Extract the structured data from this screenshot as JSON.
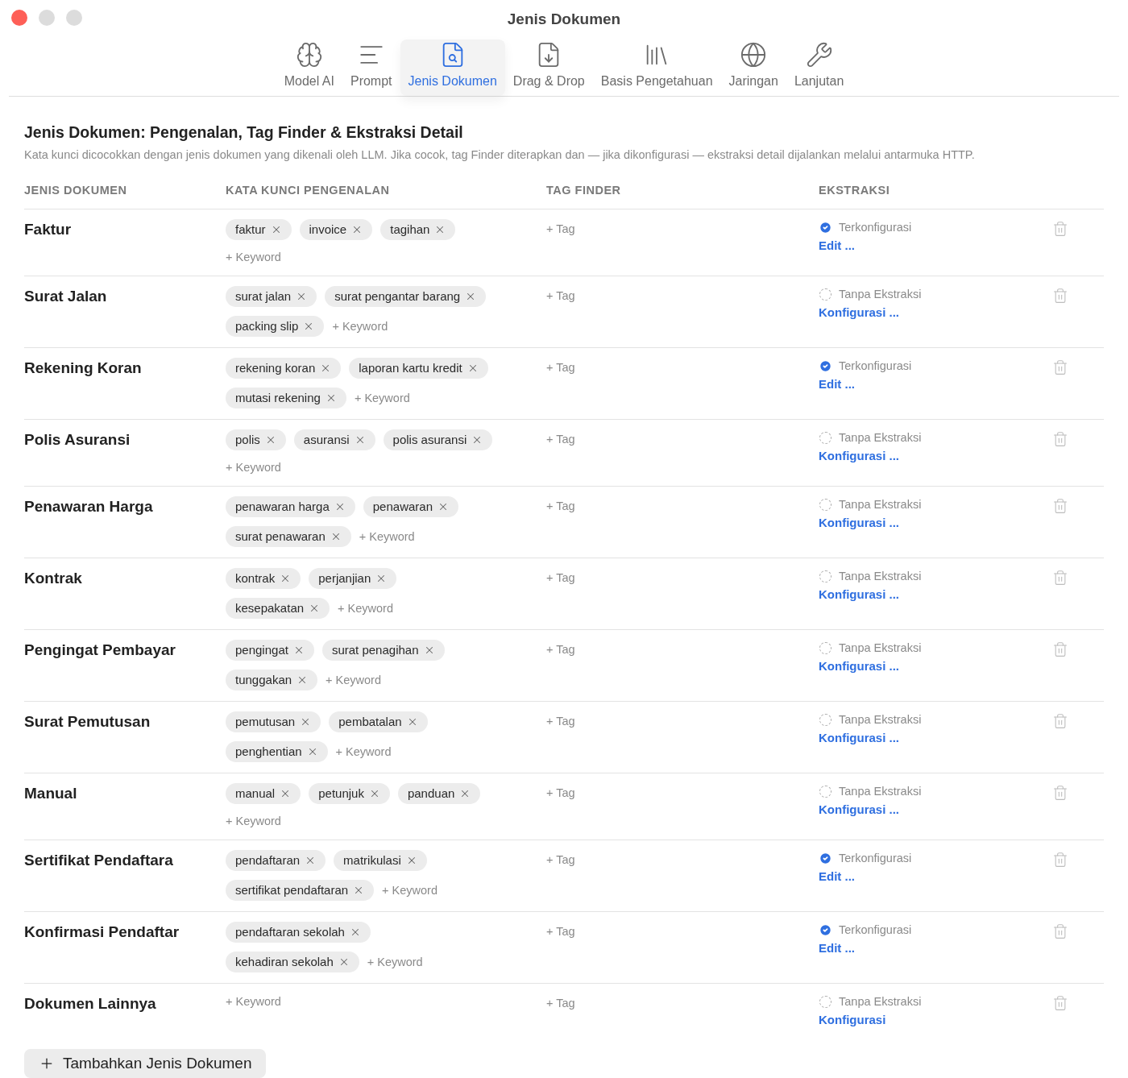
{
  "window": {
    "title": "Jenis Dokumen"
  },
  "tabs": [
    {
      "label": "Model AI",
      "selected": false
    },
    {
      "label": "Prompt",
      "selected": false
    },
    {
      "label": "Jenis Dokumen",
      "selected": true
    },
    {
      "label": "Drag & Drop",
      "selected": false
    },
    {
      "label": "Basis Pengetahuan",
      "selected": false
    },
    {
      "label": "Jaringan",
      "selected": false
    },
    {
      "label": "Lanjutan",
      "selected": false
    }
  ],
  "section": {
    "title": "Jenis Dokumen: Pengenalan, Tag Finder & Ekstraksi Detail",
    "description": "Kata kunci dicocokkan dengan jenis dokumen yang dikenali oleh LLM. Jika cocok, tag Finder diterapkan dan — jika dikonfigurasi — ekstraksi detail dijalankan melalui antarmuka HTTP."
  },
  "table": {
    "columns": [
      "JENIS DOKUMEN",
      "KATA KUNCI PENGENALAN",
      "TAG FINDER",
      "EKSTRAKSI"
    ],
    "rows": [
      {
        "name": "Faktur",
        "keywords": [
          "faktur",
          "invoice",
          "tagihan"
        ],
        "add_keyword": "+ Keyword",
        "add_tag": "+ Tag",
        "configured": true,
        "status": "Terkonfigurasi",
        "action": "Edit ..."
      },
      {
        "name": "Surat Jalan",
        "keywords": [
          "surat jalan",
          "surat pengantar barang",
          "packing slip"
        ],
        "add_keyword": "+ Keyword",
        "add_tag": "+ Tag",
        "configured": false,
        "status": "Tanpa Ekstraksi",
        "action": "Konfigurasi ..."
      },
      {
        "name": "Rekening Koran",
        "keywords": [
          "rekening koran",
          "laporan kartu kredit",
          "mutasi rekening"
        ],
        "add_keyword": "+ Keyword",
        "add_tag": "+ Tag",
        "configured": true,
        "status": "Terkonfigurasi",
        "action": "Edit ..."
      },
      {
        "name": "Polis Asuransi",
        "keywords": [
          "polis",
          "asuransi",
          "polis asuransi"
        ],
        "add_keyword": "+ Keyword",
        "add_tag": "+ Tag",
        "configured": false,
        "status": "Tanpa Ekstraksi",
        "action": "Konfigurasi ..."
      },
      {
        "name": "Penawaran Harga",
        "keywords": [
          "penawaran harga",
          "penawaran",
          "surat penawaran"
        ],
        "add_keyword": "+ Keyword",
        "add_tag": "+ Tag",
        "configured": false,
        "status": "Tanpa Ekstraksi",
        "action": "Konfigurasi ..."
      },
      {
        "name": "Kontrak",
        "keywords": [
          "kontrak",
          "perjanjian",
          "kesepakatan"
        ],
        "add_keyword": "+ Keyword",
        "add_tag": "+ Tag",
        "configured": false,
        "status": "Tanpa Ekstraksi",
        "action": "Konfigurasi ..."
      },
      {
        "name": "Pengingat Pembayar",
        "keywords": [
          "pengingat",
          "surat penagihan",
          "tunggakan"
        ],
        "add_keyword": "+ Keyword",
        "add_tag": "+ Tag",
        "configured": false,
        "status": "Tanpa Ekstraksi",
        "action": "Konfigurasi ..."
      },
      {
        "name": "Surat Pemutusan",
        "keywords": [
          "pemutusan",
          "pembatalan",
          "penghentian"
        ],
        "add_keyword": "+ Keyword",
        "add_tag": "+ Tag",
        "configured": false,
        "status": "Tanpa Ekstraksi",
        "action": "Konfigurasi ..."
      },
      {
        "name": "Manual",
        "keywords": [
          "manual",
          "petunjuk",
          "panduan"
        ],
        "add_keyword": "+ Keyword",
        "add_tag": "+ Tag",
        "configured": false,
        "status": "Tanpa Ekstraksi",
        "action": "Konfigurasi ..."
      },
      {
        "name": "Sertifikat Pendaftara",
        "keywords": [
          "pendaftaran",
          "matrikulasi",
          "sertifikat pendaftaran"
        ],
        "add_keyword": "+ Keyword",
        "add_tag": "+ Tag",
        "configured": true,
        "status": "Terkonfigurasi",
        "action": "Edit ..."
      },
      {
        "name": "Konfirmasi Pendaftar",
        "keywords": [
          "pendaftaran sekolah",
          "kehadiran sekolah"
        ],
        "add_keyword": "+ Keyword",
        "add_tag": "+ Tag",
        "configured": true,
        "status": "Terkonfigurasi",
        "action": "Edit ..."
      },
      {
        "name": "Dokumen Lainnya",
        "keywords": [],
        "add_keyword": "+ Keyword",
        "add_tag": "+ Tag",
        "configured": false,
        "status": "Tanpa Ekstraksi",
        "action": "Konfigurasi"
      }
    ]
  },
  "add_button": "Tambahkan Jenis Dokumen"
}
